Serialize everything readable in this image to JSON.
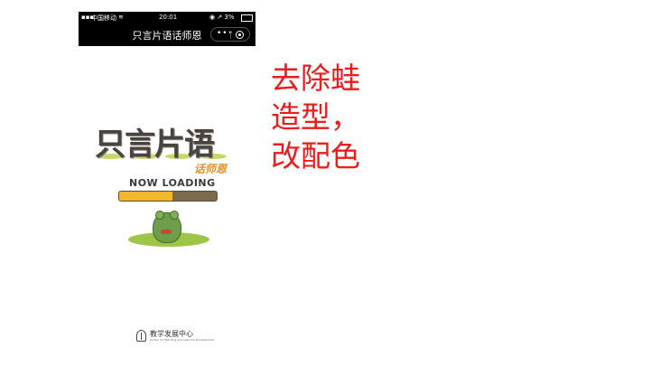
{
  "status_bar": {
    "carrier": "中国移动",
    "wifi_icon": "wifi-icon",
    "time": "20:01",
    "indicators": "◉ ↗ 3%",
    "battery_icon": "battery-icon"
  },
  "nav": {
    "title": "只言片语话师恩",
    "menu_icon": "more-dots-icon",
    "close_icon": "target-circle-icon"
  },
  "game": {
    "logo_title": "只言片语",
    "logo_subtitle": "话师恩",
    "loading_label": "NOW LOADING",
    "progress_fraction": 0.55,
    "colors": {
      "progress_fill": "#f5b52c",
      "progress_track": "#7b6a4c",
      "frog": "#6e9e4a",
      "grass": "#9ec545"
    }
  },
  "footer": {
    "org_name": "教学发展中心",
    "org_subtitle": "Center for Teaching and Learning Development"
  },
  "annotation": {
    "lines": [
      "去除蛙",
      "造型，",
      "改配色"
    ],
    "color": "#ee1b1b"
  }
}
